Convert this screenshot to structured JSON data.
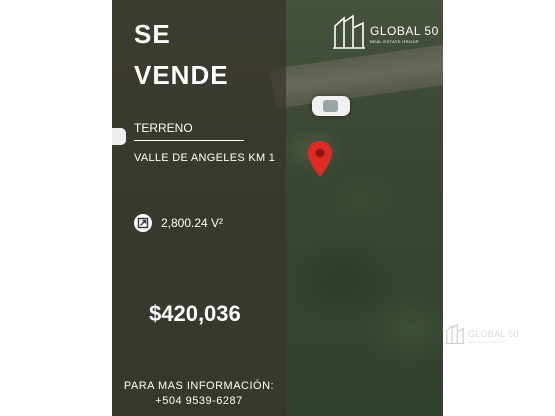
{
  "headline": {
    "line1": "SE",
    "line2": "VENDE"
  },
  "property": {
    "type": "TERRENO",
    "location": "VALLE DE ANGELES KM 1",
    "area": "2,800.24 V²"
  },
  "price": "$420,036",
  "contact": {
    "label": "PARA MAS INFORMACIÓN:",
    "phone": "+504 9539-6287"
  },
  "brand": {
    "name": "GLOBAL 50",
    "tagline": "REAL ESTATE GROUP"
  },
  "icons": {
    "area": "expand-arrow-icon",
    "location": "map-pin-icon",
    "logo": "building-logo-icon"
  },
  "colors": {
    "overlay": "#3a352e",
    "pin": "#e02a24",
    "text": "#ffffff"
  }
}
